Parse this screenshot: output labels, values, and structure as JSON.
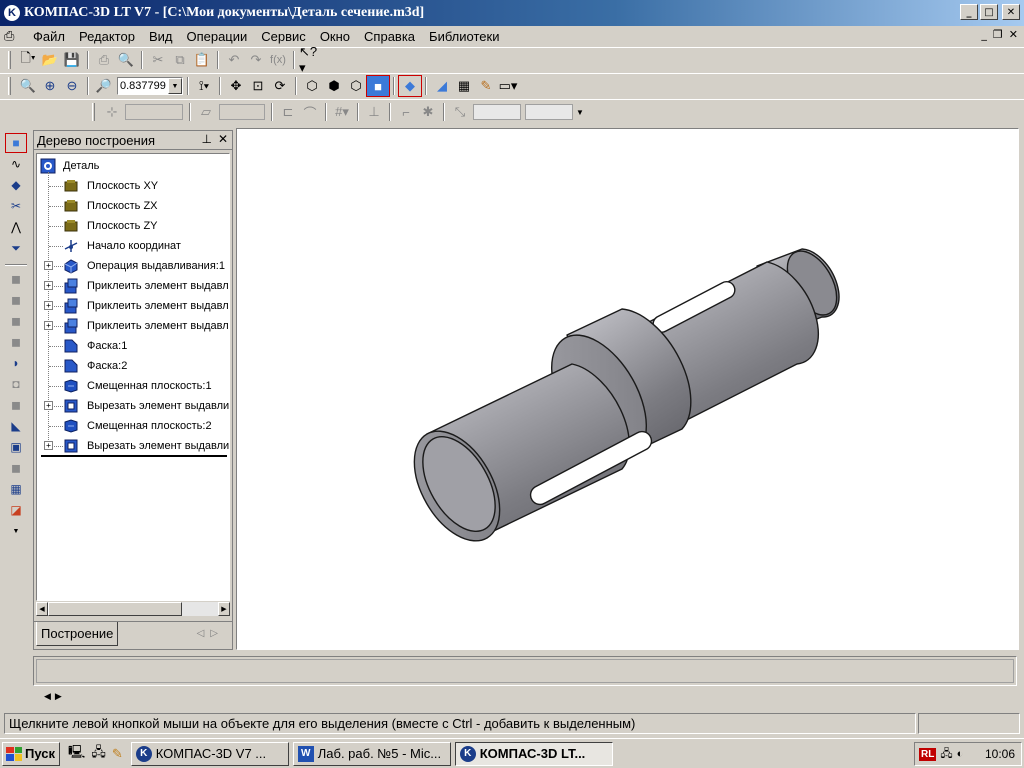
{
  "window": {
    "title": "КОМПАС-3D LT V7 - [C:\\Мои документы\\Деталь сечение.m3d]",
    "buttons": {
      "minimize": "_",
      "maximize": "□",
      "close": "✕"
    }
  },
  "menu": {
    "items": [
      "Файл",
      "Редактор",
      "Вид",
      "Операции",
      "Сервис",
      "Окно",
      "Справка",
      "Библиотеки"
    ]
  },
  "toolbar": {
    "zoom_value": "0.837799"
  },
  "tree": {
    "title": "Дерево построения",
    "root": "Деталь",
    "items": [
      {
        "label": "Плоскость XY",
        "icon": "plane-icon",
        "expandable": false
      },
      {
        "label": "Плоскость ZX",
        "icon": "plane-icon",
        "expandable": false
      },
      {
        "label": "Плоскость ZY",
        "icon": "plane-icon",
        "expandable": false
      },
      {
        "label": "Начало координат",
        "icon": "origin-icon",
        "expandable": false
      },
      {
        "label": "Операция выдавливания:1",
        "icon": "extrusion-icon",
        "expandable": true
      },
      {
        "label": "Приклеить элемент выдавл",
        "icon": "boss-extrude-icon",
        "expandable": true
      },
      {
        "label": "Приклеить элемент выдавл",
        "icon": "boss-extrude-icon",
        "expandable": true
      },
      {
        "label": "Приклеить элемент выдавл",
        "icon": "boss-extrude-icon",
        "expandable": true
      },
      {
        "label": "Фаска:1",
        "icon": "chamfer-icon",
        "expandable": false
      },
      {
        "label": "Фаска:2",
        "icon": "chamfer-icon",
        "expandable": false
      },
      {
        "label": "Смещенная плоскость:1",
        "icon": "offset-plane-icon",
        "expandable": false
      },
      {
        "label": "Вырезать элемент выдавли",
        "icon": "cut-extrude-icon",
        "expandable": true
      },
      {
        "label": "Смещенная плоскость:2",
        "icon": "offset-plane-icon",
        "expandable": false
      },
      {
        "label": "Вырезать элемент выдавли",
        "icon": "cut-extrude-icon",
        "expandable": true
      }
    ],
    "tab_label": "Построение"
  },
  "status": {
    "text": "Щелкните левой кнопкой мыши на объекте для его выделения (вместе с Ctrl - добавить к выделенным)"
  },
  "taskbar": {
    "start_label": "Пуск",
    "tasks": [
      {
        "label": "КОМПАС-3D V7 ...",
        "icon": "K",
        "active": false
      },
      {
        "label": "Лаб. раб. №5 - Mic...",
        "icon": "W",
        "active": false
      },
      {
        "label": "КОМПАС-3D LT...",
        "icon": "K",
        "active": true
      }
    ],
    "tray_lang": "RL",
    "clock": "10:06"
  },
  "colors": {
    "title_start": "#0a246a",
    "title_end": "#a6caf0",
    "face": "#d4d0c8",
    "icon_blue": "#1b3d8a",
    "model_gray": "#8c8c92"
  }
}
